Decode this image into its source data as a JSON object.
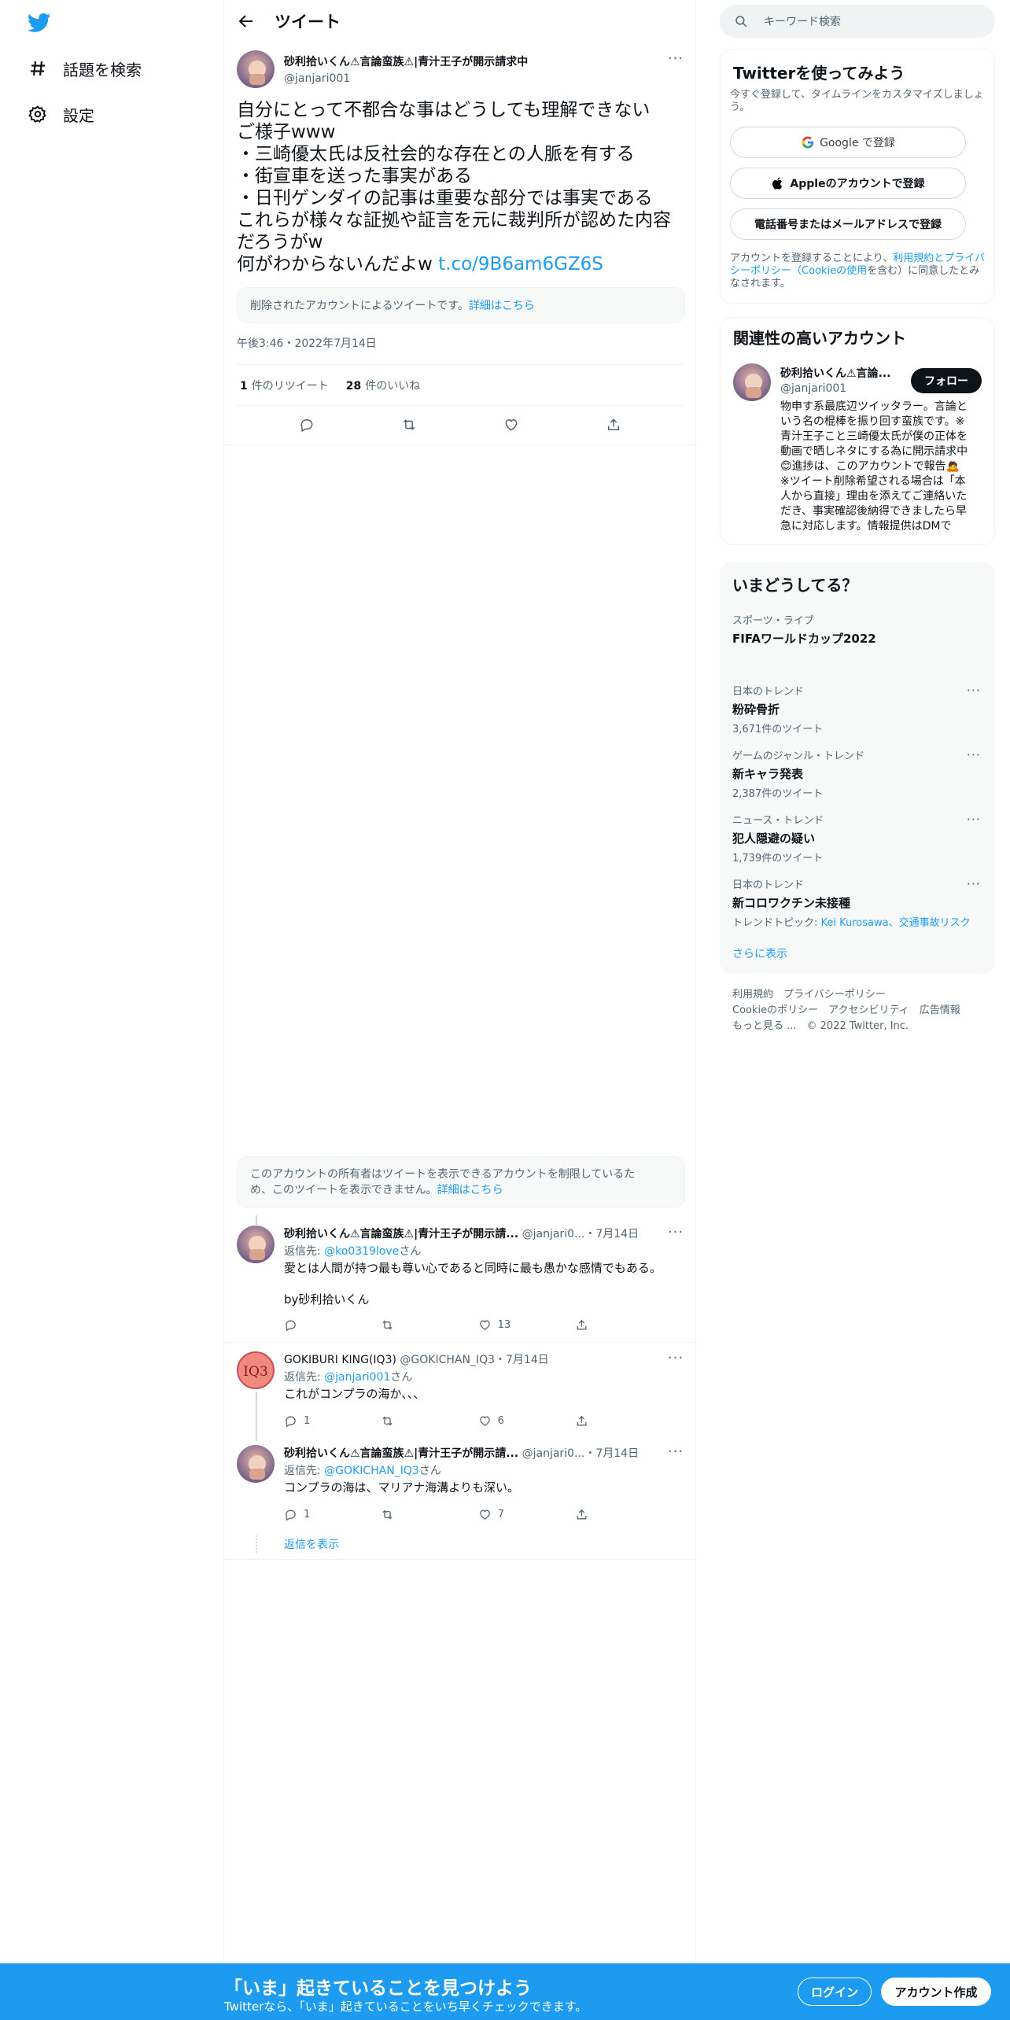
{
  "nav": {
    "explore_label": "話題を検索",
    "settings_label": "設定"
  },
  "header": {
    "title": "ツイート"
  },
  "tweet": {
    "author_name": "砂利拾いくん⚠言論蛮族⚠|青汁王子が開示請求中",
    "author_handle": "@janjari001",
    "lines": [
      "自分にとって不都合な事はどうしても理解できない",
      "ご様子www",
      "・三崎優太氏は反社会的な存在との人脈を有する",
      "・街宣車を送った事実がある",
      "・日刊ゲンダイの記事は重要な部分では事実である",
      "これらが様々な証拠や証言を元に裁判所が認めた内容",
      "だろうがw",
      "何がわからないんだよw"
    ],
    "link": "t.co/9B6am6GZ6S",
    "deleted_notice": "削除されたアカウントによるツイートです。",
    "deleted_more": "詳細はこちら",
    "timestamp": "午後3:46・2022年7月14日",
    "retweets_count": "1",
    "retweets_label": "件のリツイート",
    "likes_count": "28",
    "likes_label": "件のいいね"
  },
  "restricted": {
    "line1": "このアカウントの所有者はツイートを表示できるアカウントを制限しているた",
    "line2": "め、このツイートを表示できません。",
    "more": "詳細はこちら"
  },
  "replies": [
    {
      "name": "砂利拾いくん⚠言論蛮族⚠|青汁王子が開示請...",
      "handle": "@janjari0...",
      "date": "・7月14日",
      "reply_prefix": "返信先: ",
      "reply_to": "@ko0319love",
      "reply_suffix": "さん",
      "text1": "愛とは人間が持つ最も尊い心であると同時に最も愚かな感情でもある。",
      "text2": "by砂利拾いくん",
      "replies": "",
      "retweets": "",
      "likes": "13"
    },
    {
      "name": "GOKIBURI KING(IQ3)",
      "handle": "@GOKICHAN_IQ3",
      "date": "・7月14日",
      "reply_prefix": "返信先: ",
      "reply_to": "@janjari001",
      "reply_suffix": "さん",
      "text1": "これがコンプラの海か、、、",
      "replies": "1",
      "retweets": "",
      "likes": "6"
    },
    {
      "name": "砂利拾いくん⚠言論蛮族⚠|青汁王子が開示請...",
      "handle": "@janjari0...",
      "date": "・7月14日",
      "reply_prefix": "返信先: ",
      "reply_to": "@GOKICHAN_IQ3",
      "reply_suffix": "さん",
      "text1": "コンプラの海は、マリアナ海溝よりも深い。",
      "replies": "1",
      "retweets": "",
      "likes": "7"
    }
  ],
  "show_replies": "返信を表示",
  "avatar_iq3_text": "IQ3",
  "right": {
    "search_placeholder": "キーワード検索",
    "signup_title": "Twitterを使ってみよう",
    "signup_desc": "今すぐ登録して、タイムラインをカスタマイズしましょう。",
    "google_btn": "Google で登録",
    "apple_btn": "Appleのアカウントで登録",
    "phone_btn": "電話番号またはメールアドレスで登録",
    "terms_pre": "アカウントを登録することにより、",
    "terms_link": "利用規約とプライバシーポリシー（Cookieの使用",
    "terms_mid": "を含む）に同意したとみなされます。",
    "related_title": "関連性の高いアカウント",
    "related_name": "砂利拾いくん⚠言論...",
    "related_handle": "@janjari001",
    "follow_btn": "フォロー",
    "related_bio": [
      "物申す系最底辺ツイッタラー。言論と",
      "いう名の棍棒を振り回す蛮族です。※",
      "青汁王子こと三崎優太氏が僕の正体を",
      "動画で晒しネタにする為に開示請求中",
      "😊進捗は、このアカウントで報告🙇",
      "※ツイート削除希望される場合は「本",
      "人から直接」理由を添えてご連絡いた",
      "だき、事実確認後納得できましたら早",
      "急に対応します。情報提供はDMで"
    ],
    "happening_title": "いまどうしてる？",
    "live_cat": "スポーツ・ライブ",
    "live_name": "FIFAワールドカップ2022",
    "trends": [
      {
        "cat": "日本のトレンド",
        "name": "粉砕骨折",
        "count": "3,671件のツイート"
      },
      {
        "cat": "ゲームのジャンル・トレンド",
        "name": "新キャラ発表",
        "count": "2,387件のツイート"
      },
      {
        "cat": "ニュース・トレンド",
        "name": "犯人隠避の疑い",
        "count": "1,739件のツイート"
      },
      {
        "cat": "日本のトレンド",
        "name": "新コロワクチン未接種",
        "count": ""
      }
    ],
    "trend_topic_prefix": "トレンドトピック: ",
    "trend_topic_links": "Kei Kurosawa、交通事故リスク",
    "show_more": "さらに表示",
    "footer1": "利用規約　プライバシーポリシー",
    "footer2": "Cookieのポリシー　アクセシビリティ　広告情報",
    "footer3": "もっと見る ...　© 2022 Twitter, Inc."
  },
  "bottom": {
    "title": "「いま」起きていることを見つけよう",
    "subtitle": "Twitterなら、「いま」起きていることをいち早くチェックできます。",
    "login": "ログイン",
    "signup": "アカウント作成"
  },
  "colors": {
    "accent": "#1d9bf0",
    "text": "#0f1419",
    "muted": "#536471"
  }
}
